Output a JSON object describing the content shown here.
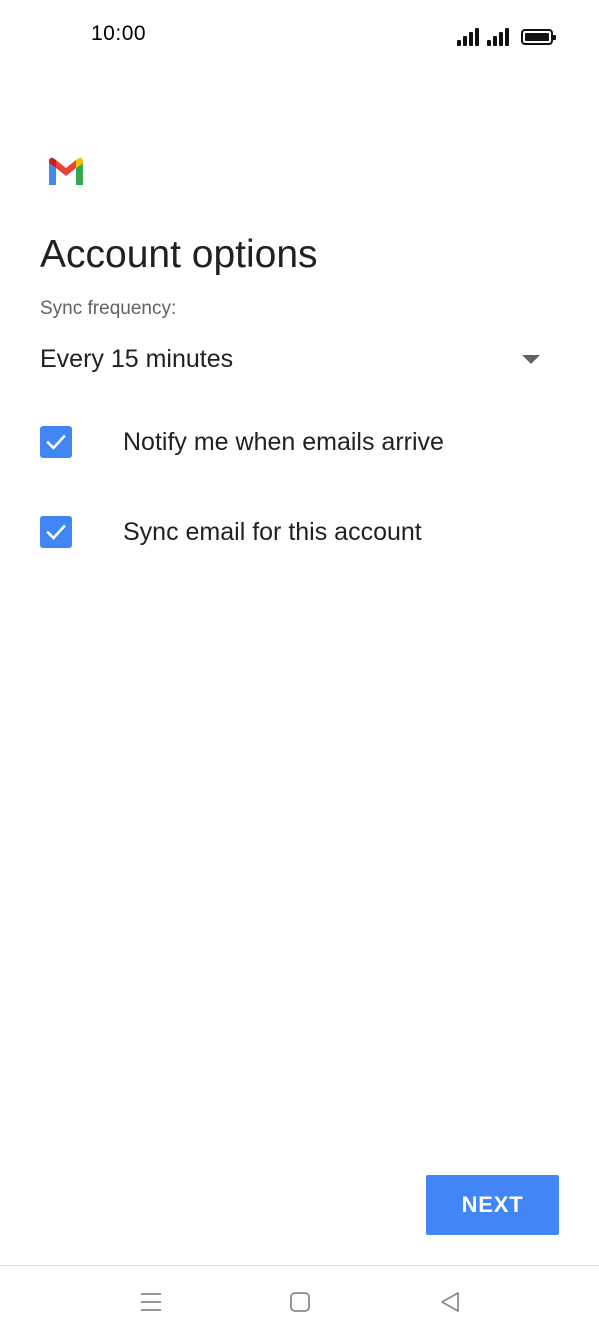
{
  "status_bar": {
    "time": "10:00"
  },
  "header": {
    "logo_icon": "gmail-logo-icon",
    "title": "Account options"
  },
  "sync": {
    "label": "Sync frequency:",
    "selected_value": "Every 15 minutes"
  },
  "options": [
    {
      "label": "Notify me when emails arrive",
      "checked": true
    },
    {
      "label": "Sync email for this account",
      "checked": true
    }
  ],
  "footer": {
    "next_label": "NEXT"
  },
  "nav": {
    "icons": [
      "menu-icon",
      "home-icon",
      "back-icon"
    ]
  },
  "colors": {
    "accent": "#4285f4",
    "gmail_red": "#ea4335",
    "gmail_blue": "#4285f4",
    "gmail_green": "#34a853",
    "gmail_yellow": "#fbbc04"
  }
}
